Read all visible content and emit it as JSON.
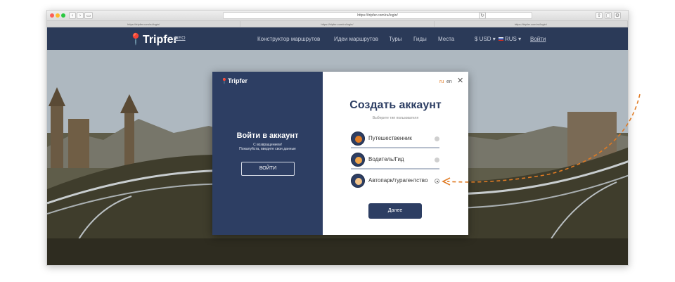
{
  "browser": {
    "address": "https://tripfer.com/ru/login/",
    "tabs": [
      "https://tripfer.com/ru/login/",
      "https://tripfer.com/ru/login/",
      "https://tripfer.com/ru/login/"
    ]
  },
  "header": {
    "logo": "Tripfer",
    "region": "GEO",
    "nav": [
      "Конструктор маршрутов",
      "Идеи маршрутов",
      "Туры",
      "Гиды",
      "Места"
    ],
    "currency": "$ USD ▾",
    "language": "RUS ▾",
    "login": "Войти"
  },
  "login_panel": {
    "logo": "Tripfer",
    "title": "Войти в аккаунт",
    "line1": "С возвращением!",
    "line2": "Пожалуйста, введите свои данные",
    "button": "ВОЙТИ"
  },
  "signup_panel": {
    "lang_ru": "ru",
    "lang_en": "en",
    "close": "✕",
    "title": "Создать аккаунт",
    "subtitle": "Выберите тип пользователя",
    "options": [
      {
        "label": "Путешественник",
        "selected": false
      },
      {
        "label": "Водитель/Гид",
        "selected": false
      },
      {
        "label": "Автопарк/турагентство",
        "selected": true
      }
    ],
    "next": "Далее"
  },
  "colors": {
    "navy": "#2d3e63",
    "accent": "#e07b24"
  }
}
